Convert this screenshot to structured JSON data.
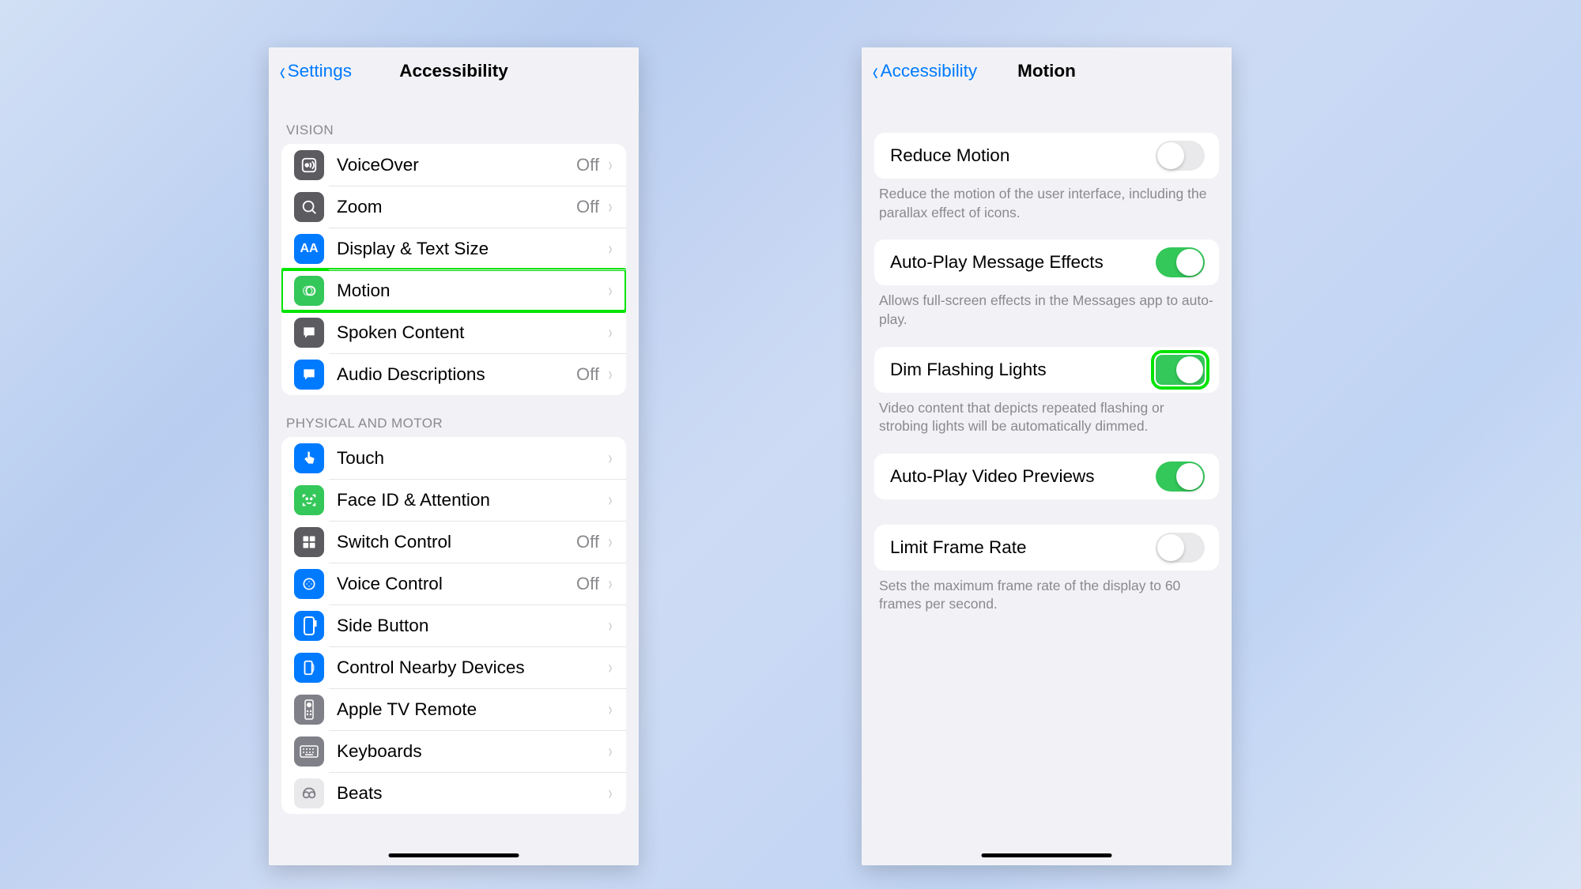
{
  "left": {
    "back": "Settings",
    "title": "Accessibility",
    "sections": {
      "vision": {
        "header": "VISION",
        "items": [
          {
            "label": "VoiceOver",
            "value": "Off"
          },
          {
            "label": "Zoom",
            "value": "Off"
          },
          {
            "label": "Display & Text Size",
            "value": ""
          },
          {
            "label": "Motion",
            "value": "",
            "highlighted": true
          },
          {
            "label": "Spoken Content",
            "value": ""
          },
          {
            "label": "Audio Descriptions",
            "value": "Off"
          }
        ]
      },
      "physical": {
        "header": "PHYSICAL AND MOTOR",
        "items": [
          {
            "label": "Touch",
            "value": ""
          },
          {
            "label": "Face ID & Attention",
            "value": ""
          },
          {
            "label": "Switch Control",
            "value": "Off"
          },
          {
            "label": "Voice Control",
            "value": "Off"
          },
          {
            "label": "Side Button",
            "value": ""
          },
          {
            "label": "Control Nearby Devices",
            "value": ""
          },
          {
            "label": "Apple TV Remote",
            "value": ""
          },
          {
            "label": "Keyboards",
            "value": ""
          },
          {
            "label": "Beats",
            "value": ""
          }
        ]
      }
    }
  },
  "right": {
    "back": "Accessibility",
    "title": "Motion",
    "rows": {
      "reduce_motion": {
        "label": "Reduce Motion",
        "on": false,
        "footer": "Reduce the motion of the user interface, including the parallax effect of icons."
      },
      "autoplay_msg": {
        "label": "Auto-Play Message Effects",
        "on": true,
        "footer": "Allows full-screen effects in the Messages app to auto-play."
      },
      "dim_flashing": {
        "label": "Dim Flashing Lights",
        "on": true,
        "highlighted": true,
        "footer": "Video content that depicts repeated flashing or strobing lights will be automatically dimmed."
      },
      "autoplay_vid": {
        "label": "Auto-Play Video Previews",
        "on": true
      },
      "limit_frame": {
        "label": "Limit Frame Rate",
        "on": false,
        "footer": "Sets the maximum frame rate of the display to 60 frames per second."
      }
    }
  }
}
